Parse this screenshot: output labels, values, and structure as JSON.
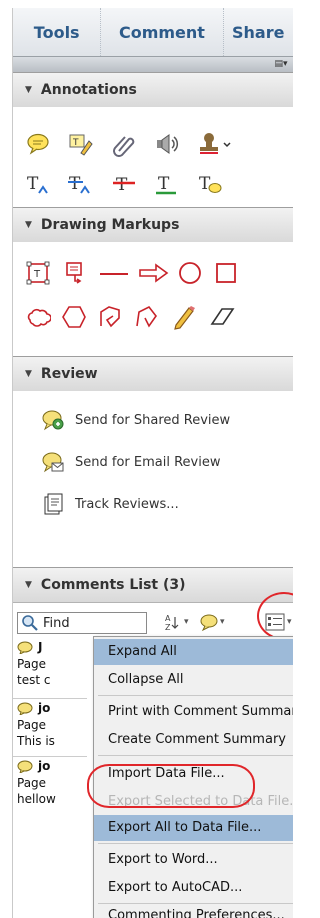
{
  "tabs": [
    "Tools",
    "Comment",
    "Share"
  ],
  "options_icon": "panel-options-icon",
  "annotations": {
    "title": "Annotations",
    "row1": [
      "sticky-note-icon",
      "highlight-text-icon",
      "attach-file-icon",
      "record-audio-icon",
      "stamp-icon"
    ],
    "row2": [
      "insert-text-icon",
      "replace-text-icon",
      "strikethrough-icon",
      "underline-icon",
      "text-comment-icon"
    ]
  },
  "drawing_markups": {
    "title": "Drawing Markups",
    "row1": [
      "text-box-icon",
      "callout-icon",
      "line-icon",
      "arrow-icon",
      "oval-icon",
      "rectangle-icon"
    ],
    "row2": [
      "cloud-icon",
      "polygon-icon",
      "connected-lines-icon",
      "pencil-icon",
      "eraser-icon"
    ]
  },
  "review": {
    "title": "Review",
    "items": [
      {
        "label": "Send for Shared Review",
        "icon": "shared-review-icon"
      },
      {
        "label": "Send for Email Review",
        "icon": "email-review-icon"
      },
      {
        "label": "Track Reviews...",
        "icon": "track-reviews-icon"
      }
    ]
  },
  "comments_list": {
    "title": "Comments List (3)",
    "find_label": "Find",
    "items": [
      {
        "author": "J",
        "page": "Page",
        "text": "test c"
      },
      {
        "author": "jo",
        "page": "Page",
        "text": "This is"
      },
      {
        "author": "jo",
        "page": "Page",
        "text": "hellow"
      }
    ]
  },
  "menu": {
    "items": [
      {
        "label": "Expand All",
        "state": "highlighted"
      },
      {
        "label": "Collapse All",
        "state": "normal"
      },
      {
        "label": "Print with Comment Summary",
        "state": "normal"
      },
      {
        "label": "Create Comment Summary",
        "state": "normal"
      },
      {
        "label": "Import Data File...",
        "state": "normal"
      },
      {
        "label": "Export Selected to Data File...",
        "state": "disabled"
      },
      {
        "label": "Export All to Data File...",
        "state": "highlighted"
      },
      {
        "label": "Export to Word...",
        "state": "normal"
      },
      {
        "label": "Export to AutoCAD...",
        "state": "normal"
      },
      {
        "label": "Commenting Preferences...",
        "state": "normal"
      }
    ]
  },
  "colors": {
    "tab_text": "#2d5b8a",
    "annotation_red": "#c8232a",
    "highlight": "#9dbad8",
    "callout_circle": "#e0262a"
  }
}
